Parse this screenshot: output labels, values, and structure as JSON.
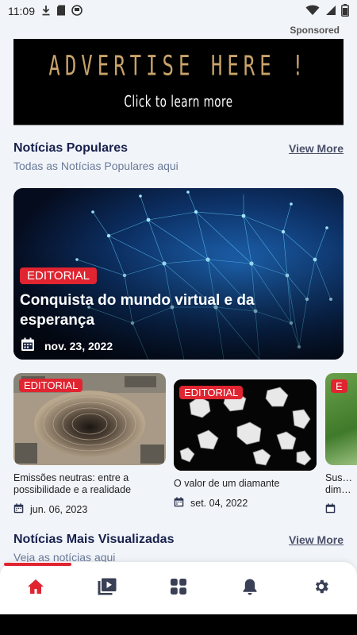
{
  "status_bar": {
    "time": "11:09"
  },
  "sponsored_label": "Sponsored",
  "ad": {
    "headline": "ADVERTISE HERE !",
    "subline": "Click to learn more"
  },
  "popular": {
    "title": "Notícias Populares",
    "subtitle": "Todas as Notícias Populares aqui",
    "view_more": "View More",
    "featured": {
      "category": "EDITORIAL",
      "title": "Conquista do mundo virtual e da esperança",
      "date": "nov. 23, 2022"
    },
    "cards": [
      {
        "category": "EDITORIAL",
        "title": "Emissões neutras: entre a possibilidade e a realidade",
        "date": "jun. 06, 2023"
      },
      {
        "category": "EDITORIAL",
        "title": "O valor de um diamante",
        "date": "set. 04, 2022"
      },
      {
        "category": "E",
        "title": "Sus… dim…",
        "date": ""
      }
    ]
  },
  "most_viewed": {
    "title": "Notícias Mais Visualizadas",
    "subtitle": "Veja as notícias aqui",
    "view_more": "View More"
  },
  "bottom_nav": [
    {
      "icon": "home-icon",
      "active": true
    },
    {
      "icon": "video-library-icon",
      "active": false
    },
    {
      "icon": "grid-icon",
      "active": false
    },
    {
      "icon": "bell-icon",
      "active": false
    },
    {
      "icon": "settings-icon",
      "active": false
    }
  ],
  "colors": {
    "accent": "#e02430",
    "title": "#18214d",
    "subtitle": "#6a7a99",
    "background": "#f1f4f9"
  }
}
